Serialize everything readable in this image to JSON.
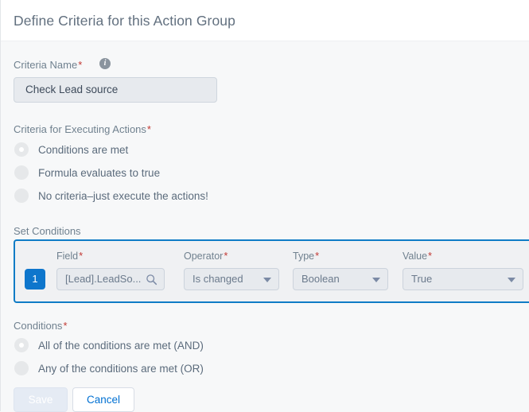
{
  "header": {
    "title": "Define Criteria for this Action Group"
  },
  "criteria_name": {
    "label": "Criteria Name",
    "required_mark": "*",
    "info_icon": "info-icon",
    "info_glyph": "i",
    "value": "Check Lead source"
  },
  "criteria_for_executing_actions": {
    "label": "Criteria for Executing Actions",
    "required_mark": "*",
    "options": [
      {
        "label": "Conditions are met",
        "selected": true
      },
      {
        "label": "Formula evaluates to true",
        "selected": false
      },
      {
        "label": "No criteria–just execute the actions!",
        "selected": false
      }
    ]
  },
  "set_conditions": {
    "label": "Set Conditions",
    "columns": {
      "field": "Field",
      "operator": "Operator",
      "type": "Type",
      "value": "Value"
    },
    "required_mark": "*",
    "rows": [
      {
        "number": "1",
        "field": "[Lead].LeadSo...",
        "field_icon": "search-icon",
        "operator": "Is changed",
        "type": "Boolean",
        "value": "True"
      }
    ]
  },
  "conditions": {
    "label": "Conditions",
    "required_mark": "*",
    "options": [
      {
        "label": "All of the conditions are met (AND)",
        "selected": true
      },
      {
        "label": "Any of the conditions are met (OR)",
        "selected": false
      }
    ]
  },
  "footer": {
    "save_label": "Save",
    "cancel_label": "Cancel"
  },
  "colors": {
    "accent_blue": "#0e76cc",
    "link_blue": "#0070d2",
    "required_red": "#c23934",
    "label_gray": "#70818f",
    "panel_bg": "#f7f8f9"
  }
}
